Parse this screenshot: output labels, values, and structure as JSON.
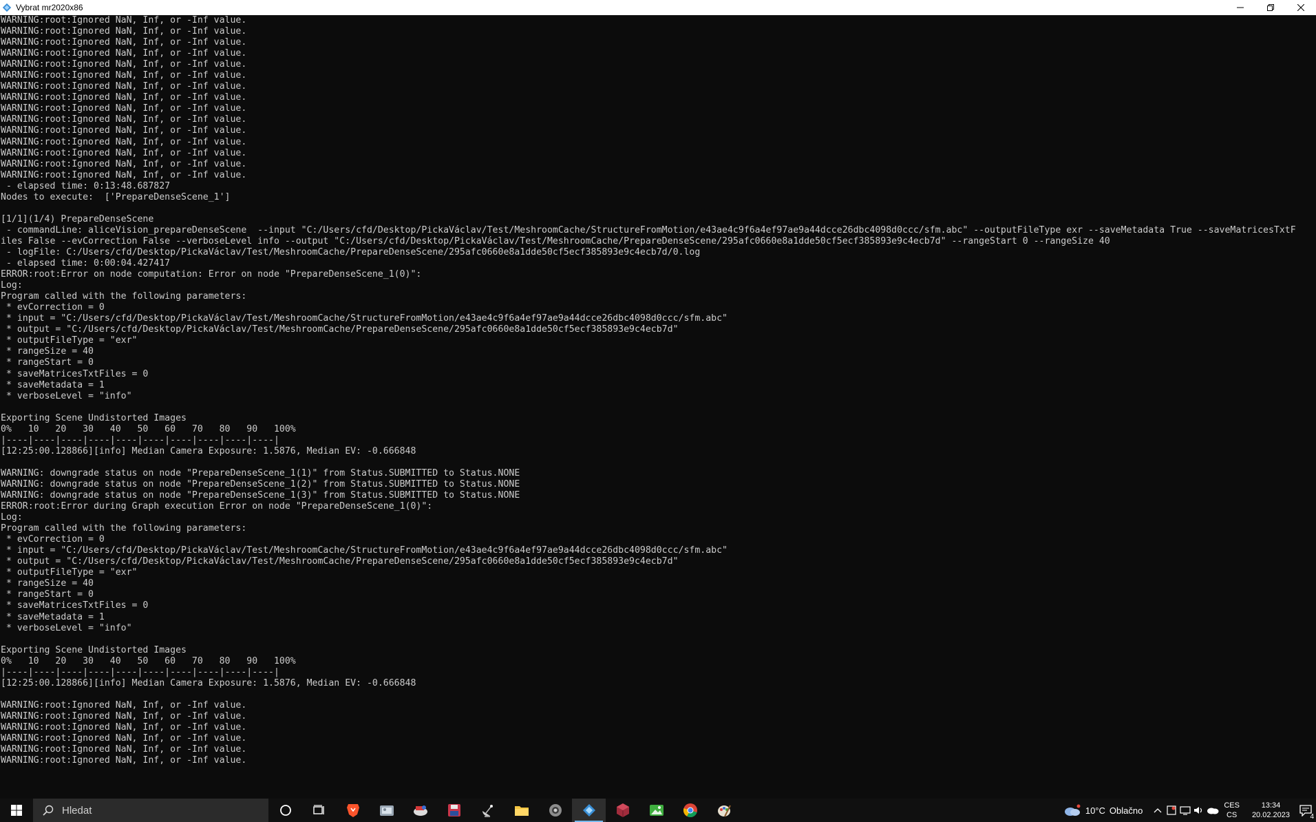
{
  "window": {
    "title": "Vybrat mr2020x86"
  },
  "console_lines": [
    "WARNING:root:Ignored NaN, Inf, or -Inf value.",
    "WARNING:root:Ignored NaN, Inf, or -Inf value.",
    "WARNING:root:Ignored NaN, Inf, or -Inf value.",
    "WARNING:root:Ignored NaN, Inf, or -Inf value.",
    "WARNING:root:Ignored NaN, Inf, or -Inf value.",
    "WARNING:root:Ignored NaN, Inf, or -Inf value.",
    "WARNING:root:Ignored NaN, Inf, or -Inf value.",
    "WARNING:root:Ignored NaN, Inf, or -Inf value.",
    "WARNING:root:Ignored NaN, Inf, or -Inf value.",
    "WARNING:root:Ignored NaN, Inf, or -Inf value.",
    "WARNING:root:Ignored NaN, Inf, or -Inf value.",
    "WARNING:root:Ignored NaN, Inf, or -Inf value.",
    "WARNING:root:Ignored NaN, Inf, or -Inf value.",
    "WARNING:root:Ignored NaN, Inf, or -Inf value.",
    "WARNING:root:Ignored NaN, Inf, or -Inf value.",
    " - elapsed time: 0:13:48.687827",
    "Nodes to execute:  ['PrepareDenseScene_1']",
    "",
    "[1/1](1/4) PrepareDenseScene",
    " - commandLine: aliceVision_prepareDenseScene  --input \"C:/Users/cfd/Desktop/PickaVáclav/Test/MeshroomCache/StructureFromMotion/e43ae4c9f6a4ef97ae9a44dcce26dbc4098d0ccc/sfm.abc\" --outputFileType exr --saveMetadata True --saveMatricesTxtF",
    "iles False --evCorrection False --verboseLevel info --output \"C:/Users/cfd/Desktop/PickaVáclav/Test/MeshroomCache/PrepareDenseScene/295afc0660e8a1dde50cf5ecf385893e9c4ecb7d\" --rangeStart 0 --rangeSize 40",
    " - logFile: C:/Users/cfd/Desktop/PickaVáclav/Test/MeshroomCache/PrepareDenseScene/295afc0660e8a1dde50cf5ecf385893e9c4ecb7d/0.log",
    " - elapsed time: 0:00:04.427417",
    "ERROR:root:Error on node computation: Error on node \"PrepareDenseScene_1(0)\":",
    "Log:",
    "Program called with the following parameters:",
    " * evCorrection = 0",
    " * input = \"C:/Users/cfd/Desktop/PickaVáclav/Test/MeshroomCache/StructureFromMotion/e43ae4c9f6a4ef97ae9a44dcce26dbc4098d0ccc/sfm.abc\"",
    " * output = \"C:/Users/cfd/Desktop/PickaVáclav/Test/MeshroomCache/PrepareDenseScene/295afc0660e8a1dde50cf5ecf385893e9c4ecb7d\"",
    " * outputFileType = \"exr\"",
    " * rangeSize = 40",
    " * rangeStart = 0",
    " * saveMatricesTxtFiles = 0",
    " * saveMetadata = 1",
    " * verboseLevel = \"info\"",
    "",
    "Exporting Scene Undistorted Images",
    "0%   10   20   30   40   50   60   70   80   90   100%",
    "|----|----|----|----|----|----|----|----|----|----|",
    "[12:25:00.128866][info] Median Camera Exposure: 1.5876, Median EV: -0.666848",
    "",
    "WARNING: downgrade status on node \"PrepareDenseScene_1(1)\" from Status.SUBMITTED to Status.NONE",
    "WARNING: downgrade status on node \"PrepareDenseScene_1(2)\" from Status.SUBMITTED to Status.NONE",
    "WARNING: downgrade status on node \"PrepareDenseScene_1(3)\" from Status.SUBMITTED to Status.NONE",
    "ERROR:root:Error during Graph execution Error on node \"PrepareDenseScene_1(0)\":",
    "Log:",
    "Program called with the following parameters:",
    " * evCorrection = 0",
    " * input = \"C:/Users/cfd/Desktop/PickaVáclav/Test/MeshroomCache/StructureFromMotion/e43ae4c9f6a4ef97ae9a44dcce26dbc4098d0ccc/sfm.abc\"",
    " * output = \"C:/Users/cfd/Desktop/PickaVáclav/Test/MeshroomCache/PrepareDenseScene/295afc0660e8a1dde50cf5ecf385893e9c4ecb7d\"",
    " * outputFileType = \"exr\"",
    " * rangeSize = 40",
    " * rangeStart = 0",
    " * saveMatricesTxtFiles = 0",
    " * saveMetadata = 1",
    " * verboseLevel = \"info\"",
    "",
    "Exporting Scene Undistorted Images",
    "0%   10   20   30   40   50   60   70   80   90   100%",
    "|----|----|----|----|----|----|----|----|----|----|",
    "[12:25:00.128866][info] Median Camera Exposure: 1.5876, Median EV: -0.666848",
    "",
    "WARNING:root:Ignored NaN, Inf, or -Inf value.",
    "WARNING:root:Ignored NaN, Inf, or -Inf value.",
    "WARNING:root:Ignored NaN, Inf, or -Inf value.",
    "WARNING:root:Ignored NaN, Inf, or -Inf value.",
    "WARNING:root:Ignored NaN, Inf, or -Inf value.",
    "WARNING:root:Ignored NaN, Inf, or -Inf value."
  ],
  "taskbar": {
    "search_placeholder": "Hledat",
    "apps": [
      "cortana-icon",
      "task-view-icon",
      "brave-browser-icon",
      "photo-viewer-icon",
      "satellite-app-icon",
      "save-disk-icon",
      "satellite-dish-icon",
      "file-explorer-icon",
      "gear-app-icon",
      "meshroom-icon",
      "cube-app-icon",
      "image-viewer-icon",
      "chrome-icon",
      "paint-icon"
    ],
    "weather_temp": "10°C",
    "weather_text": "Oblačno",
    "lang_top": "CES",
    "lang_bottom": "CS",
    "time": "13:34",
    "date": "20.02.2023",
    "notification_count": "4"
  },
  "colors": {
    "console_bg": "#0c0c0c",
    "console_text": "#cccccc",
    "taskbar_bg": "#101010",
    "accent": "#76b9ed"
  }
}
